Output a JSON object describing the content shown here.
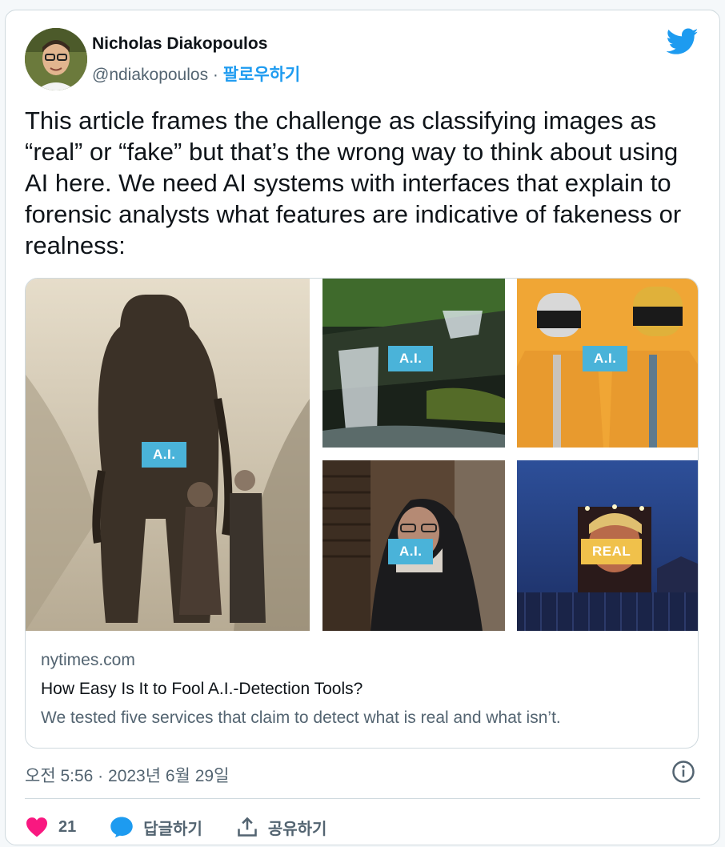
{
  "user": {
    "name": "Nicholas Diakopoulos",
    "handle": "@ndiakopoulos",
    "separator": " · ",
    "follow_label": "팔로우하기"
  },
  "tweet": {
    "text": "This article frames the challenge as classifying images as “real” or “fake” but that’s the wrong way to think about using AI here. We need AI systems with interfaces that explain to forensic analysts what features are indicative of fakeness or realness:"
  },
  "media": {
    "tags": [
      "A.I.",
      "A.I.",
      "A.I.",
      "A.I.",
      "REAL"
    ],
    "domain": "nytimes.com",
    "title": "How Easy Is It to Fool A.I.-Detection Tools?",
    "description": "We tested five services that claim to detect what is real and what isn’t."
  },
  "timestamp": "오전 5:56 · 2023년 6월 29일",
  "actions": {
    "likes": "21",
    "reply_label": "답글하기",
    "share_label": "공유하기"
  },
  "colors": {
    "accent": "#1d9bf0",
    "like": "#f91880",
    "tag_ai": "#4ab3d9",
    "tag_real": "#f0c14b"
  }
}
